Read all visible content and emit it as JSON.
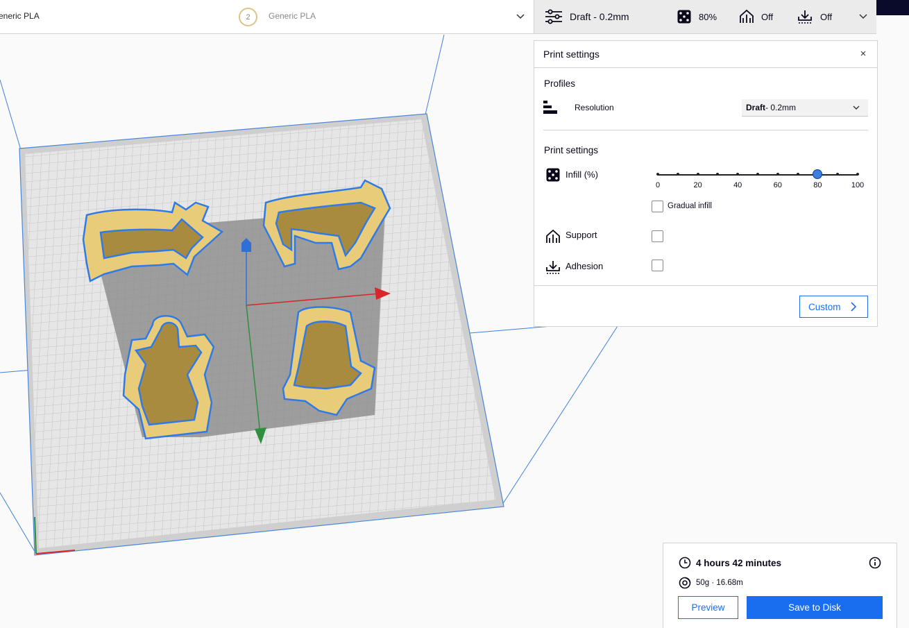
{
  "material_bar": {
    "extruder1_material": "eneric PLA",
    "extruder2_number": "2",
    "extruder2_material": "Generic PLA"
  },
  "settings_bar": {
    "profile": "Draft - 0.2mm",
    "infill": "80%",
    "support": "Off",
    "adhesion": "Off"
  },
  "print_settings": {
    "title": "Print settings",
    "close": "×",
    "profiles_heading": "Profiles",
    "resolution_label": "Resolution",
    "resolution_value_bold": "Draft",
    "resolution_value_rest": " - 0.2mm",
    "settings_heading": "Print settings",
    "infill_label": "Infill (%)",
    "infill_value": 80,
    "infill_ticks": [
      "0",
      "20",
      "40",
      "60",
      "80",
      "100"
    ],
    "gradual_infill_label": "Gradual infill",
    "gradual_infill_checked": false,
    "support_label": "Support",
    "support_checked": false,
    "adhesion_label": "Adhesion",
    "adhesion_checked": false,
    "custom_button": "Custom"
  },
  "action_panel": {
    "print_time": "4 hours 42 minutes",
    "material_usage": "50g · 16.68m",
    "preview_button": "Preview",
    "save_button": "Save to Disk"
  },
  "colors": {
    "accent": "#196ef0",
    "model_fill": "#e8cc7a",
    "model_outline": "#2f7ae5",
    "buildplate": "#e2e2e2",
    "axis_x": "#d9262b",
    "axis_y": "#2f8f3e",
    "axis_z": "#2f6fd6"
  },
  "icons": {
    "settings_bar": [
      "sliders-icon",
      "infill-icon",
      "support-icon",
      "adhesion-icon",
      "chevron-down-icon"
    ],
    "action_panel": [
      "clock-icon",
      "spool-icon",
      "info-icon"
    ]
  }
}
